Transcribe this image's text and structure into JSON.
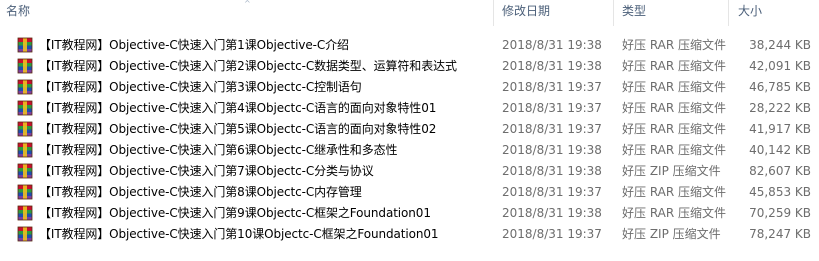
{
  "columns": {
    "name": "名称",
    "date": "修改日期",
    "type": "类型",
    "size": "大小"
  },
  "sort_indicator": "^",
  "files": [
    {
      "name": "【IT教程网】Objective-C快速入门第1课Objective-C介绍",
      "date": "2018/8/31 19:38",
      "type": "好压 RAR 压缩文件",
      "size": "38,244 KB",
      "icon": "rar-archive-icon"
    },
    {
      "name": "【IT教程网】Objective-C快速入门第2课Objectc-C数据类型、运算符和表达式",
      "date": "2018/8/31 19:38",
      "type": "好压 RAR 压缩文件",
      "size": "42,091 KB",
      "icon": "rar-archive-icon"
    },
    {
      "name": "【IT教程网】Objective-C快速入门第3课Objectc-C控制语句",
      "date": "2018/8/31 19:37",
      "type": "好压 RAR 压缩文件",
      "size": "46,785 KB",
      "icon": "rar-archive-icon"
    },
    {
      "name": "【IT教程网】Objective-C快速入门第4课Objectc-C语言的面向对象特性01",
      "date": "2018/8/31 19:37",
      "type": "好压 RAR 压缩文件",
      "size": "28,222 KB",
      "icon": "rar-archive-icon"
    },
    {
      "name": "【IT教程网】Objective-C快速入门第5课Objectc-C语言的面向对象特性02",
      "date": "2018/8/31 19:37",
      "type": "好压 RAR 压缩文件",
      "size": "41,917 KB",
      "icon": "rar-archive-icon"
    },
    {
      "name": "【IT教程网】Objective-C快速入门第6课Objectc-C继承性和多态性",
      "date": "2018/8/31 19:38",
      "type": "好压 RAR 压缩文件",
      "size": "40,142 KB",
      "icon": "rar-archive-icon"
    },
    {
      "name": "【IT教程网】Objective-C快速入门第7课Objectc-C分类与协议",
      "date": "2018/8/31 19:38",
      "type": "好压 ZIP 压缩文件",
      "size": "82,607 KB",
      "icon": "rar-archive-icon"
    },
    {
      "name": "【IT教程网】Objective-C快速入门第8课Objectc-C内存管理",
      "date": "2018/8/31 19:37",
      "type": "好压 RAR 压缩文件",
      "size": "45,853 KB",
      "icon": "rar-archive-icon"
    },
    {
      "name": "【IT教程网】Objective-C快速入门第9课Objectc-C框架之Foundation01",
      "date": "2018/8/31 19:38",
      "type": "好压 RAR 压缩文件",
      "size": "70,259 KB",
      "icon": "rar-archive-icon"
    },
    {
      "name": "【IT教程网】Objective-C快速入门第10课Objectc-C框架之Foundation01",
      "date": "2018/8/31 19:37",
      "type": "好压 ZIP 压缩文件",
      "size": "78,247 KB",
      "icon": "rar-archive-icon"
    }
  ],
  "colors": {
    "header_text": "#4c607a",
    "detail_text": "#6d6d6d",
    "name_text": "#000000",
    "column_separator": "#e5e5e5",
    "icon_red": "#c8102e",
    "icon_blue": "#1c4fb0",
    "icon_green": "#2e9a3c",
    "icon_yellow": "#f0c020"
  }
}
